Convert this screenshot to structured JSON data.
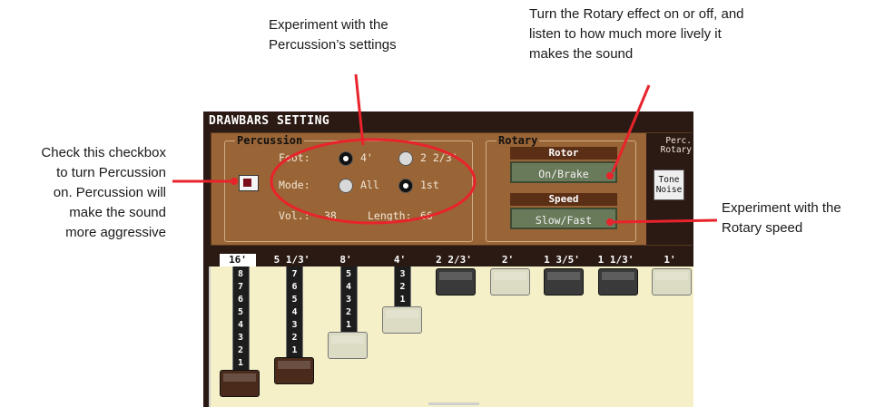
{
  "callouts": {
    "percussion_settings": [
      "Experiment with the",
      "Percussion’s settings"
    ],
    "rotary_effect": [
      "Turn the Rotary effect on or off, and",
      "listen to how much more lively it",
      "makes the sound"
    ],
    "checkbox": [
      "Check this checkbox",
      "to turn Percussion",
      "on. Percussion will",
      "make the sound",
      "more aggressive"
    ],
    "rotary_speed": [
      "Experiment with the",
      "Rotary speed"
    ]
  },
  "screen": {
    "title": "DRAWBARS SETTING",
    "percussion": {
      "title": "Percussion",
      "foot_label": "Foot:",
      "foot_options": [
        "4'",
        "2 2/3'"
      ],
      "foot_selected": "4'",
      "mode_label": "Mode:",
      "mode_options": [
        "All",
        "1st"
      ],
      "mode_selected": "1st",
      "vol_label": "Vol.:",
      "vol_value": "38",
      "length_label": "Length:",
      "length_value": "66",
      "checkbox_checked": true
    },
    "rotary": {
      "title": "Rotary",
      "rotor_header": "Rotor",
      "rotor_button": "On/Brake",
      "speed_header": "Speed",
      "speed_button": "Slow/Fast"
    },
    "side_tab": {
      "label_line1": "Perc.",
      "label_line2": "Rotary",
      "tone_line1": "Tone",
      "tone_line2": "Noise"
    },
    "drawbars": [
      {
        "foot": "16'",
        "numbers": [
          "8",
          "7",
          "6",
          "5",
          "4",
          "3",
          "2",
          "1"
        ],
        "level": 8,
        "active": true
      },
      {
        "foot": "5 1/3'",
        "numbers": [
          "7",
          "6",
          "5",
          "4",
          "3",
          "2",
          "1"
        ],
        "level": 7,
        "active": false
      },
      {
        "foot": "8'",
        "numbers": [
          "5",
          "4",
          "3",
          "2",
          "1"
        ],
        "level": 5,
        "active": false
      },
      {
        "foot": "4'",
        "numbers": [
          "3",
          "2",
          "1"
        ],
        "level": 3,
        "active": false
      },
      {
        "foot": "2 2/3'",
        "numbers": [],
        "level": 0,
        "active": false
      },
      {
        "foot": "2'",
        "numbers": [],
        "level": 0,
        "active": false
      },
      {
        "foot": "1 3/5'",
        "numbers": [],
        "level": 0,
        "active": false
      },
      {
        "foot": "1 1/3'",
        "numbers": [],
        "level": 0,
        "active": false
      },
      {
        "foot": "1'",
        "numbers": [],
        "level": 0,
        "active": false
      }
    ]
  },
  "colors": {
    "panel_brown": "#9a6536",
    "frame_dark": "#2b1a14",
    "button_green": "#697a5a",
    "header_brown": "#5b2e16",
    "drawbar_area": "#f6f0c8",
    "callout_line": "#e8232c"
  }
}
